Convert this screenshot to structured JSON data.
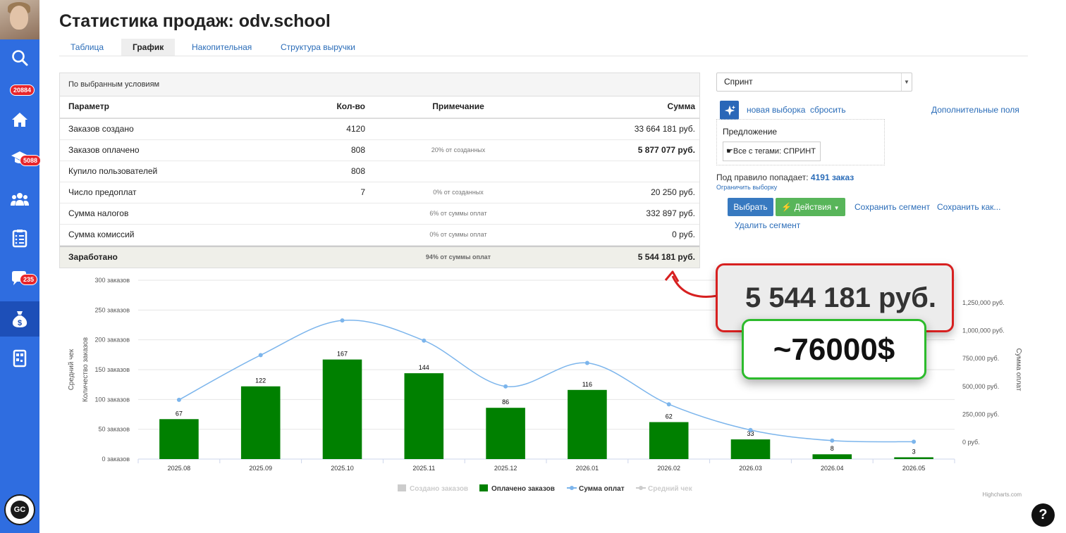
{
  "page_title": "Статистика продаж: odv.school",
  "tabs": [
    "Таблица",
    "График",
    "Накопительная",
    "Структура выручки"
  ],
  "sidebar": {
    "badges": {
      "notifications": "20884",
      "courses": "5088",
      "messages": "235"
    },
    "logo_text": "GC",
    "icons": [
      "search-icon",
      "home-icon",
      "graduation-cap-icon",
      "users-icon",
      "checklist-icon",
      "chat-icon",
      "money-bag-icon",
      "qr-icon"
    ]
  },
  "stats": {
    "caption": "По выбранным условиям",
    "headers": {
      "param": "Параметр",
      "count": "Кол-во",
      "note": "Примечание",
      "sum": "Сумма"
    },
    "rows": [
      {
        "param": "Заказов создано",
        "count": "4120",
        "note": "",
        "sum": "33 664 181 руб."
      },
      {
        "param": "Заказов оплачено",
        "count": "808",
        "note": "20% от созданных",
        "sum": "5 877 077 руб."
      },
      {
        "param": "Купило пользователей",
        "count": "808",
        "note": "",
        "sum": ""
      },
      {
        "param": "Число предоплат",
        "count": "7",
        "note": "0% от созданных",
        "sum": "20 250 руб."
      },
      {
        "param": "Сумма налогов",
        "count": "",
        "note": "6% от суммы оплат",
        "sum": "332 897 руб."
      },
      {
        "param": "Сумма комиссий",
        "count": "",
        "note": "0% от суммы оплат",
        "sum": "0 руб."
      }
    ],
    "total": {
      "param": "Заработано",
      "note": "94% от суммы оплат",
      "sum": "5 544 181 руб."
    }
  },
  "filter": {
    "select_value": "Спринт",
    "new_selection": "новая выборка",
    "reset": "сбросить",
    "extra_fields": "Дополнительные поля",
    "offer_label": "Предложение",
    "offer_chip": "Все с тегами: СПРИНТ",
    "rule_text": "Под правило попадает:",
    "rule_count": "4191 заказ",
    "limit": "Ограничить выборку",
    "btn_select": "Выбрать",
    "btn_actions": "Действия",
    "save_segment": "Сохранить сегмент",
    "save_as": "Сохранить как...",
    "delete_segment": "Удалить сегмент"
  },
  "chart_data": {
    "type": "bar",
    "categories": [
      "2025.08",
      "2025.09",
      "2025.10",
      "2025.11",
      "2025.12",
      "2026.01",
      "2026.02",
      "2026.03",
      "2026.04",
      "2026.05"
    ],
    "series": [
      {
        "name": "Создано заказов",
        "visible": false,
        "values": []
      },
      {
        "name": "Оплачено заказов",
        "type": "bar",
        "color": "#008000",
        "values": [
          67,
          122,
          167,
          144,
          86,
          116,
          62,
          33,
          8,
          3
        ]
      },
      {
        "name": "Сумма оплат",
        "type": "line",
        "color": "#7cb5ec",
        "values": [
          380000,
          780000,
          1090000,
          910000,
          500000,
          710000,
          340000,
          110000,
          15000,
          5000
        ]
      },
      {
        "name": "Средний чек",
        "visible": false,
        "values": []
      }
    ],
    "y_left": {
      "label": "Количество заказов",
      "ticks": [
        "0 заказов",
        "50 заказов",
        "100 заказов",
        "150 заказов",
        "200 заказов",
        "250 заказов",
        "300 заказов"
      ],
      "min": 0,
      "max": 300
    },
    "y_left2": {
      "label": "Средний чек"
    },
    "y_right": {
      "label": "Сумма оплат",
      "ticks": [
        "0 руб.",
        "250,000 руб.",
        "500,000 руб.",
        "750,000 руб.",
        "1,000,000 руб.",
        "1,250,000 руб."
      ],
      "min": -150000,
      "max": 1450000
    },
    "credit": "Highcharts.com",
    "legend_position": "bottom"
  },
  "annotations": {
    "callout_sum": "5 544 181 руб.",
    "callout_usd": "~76000$"
  },
  "help_label": "?"
}
